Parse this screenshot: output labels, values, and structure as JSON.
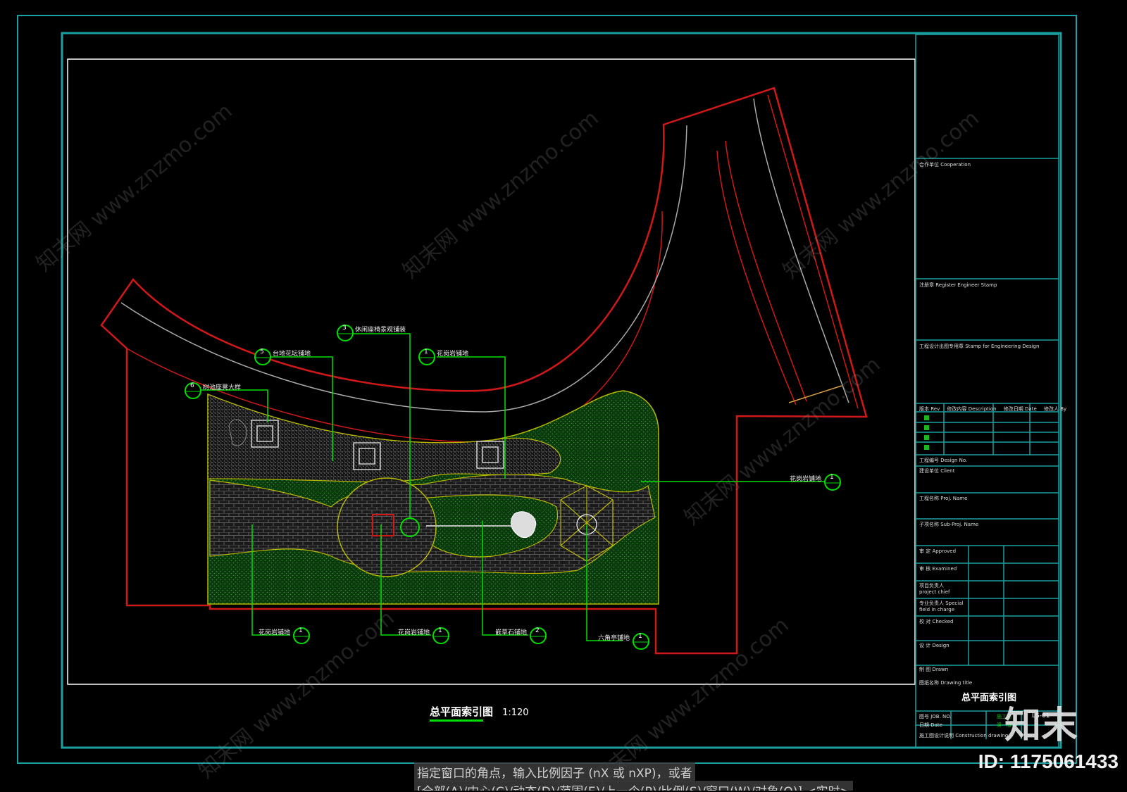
{
  "drawing": {
    "title": "总平面索引图",
    "scale": "1:120",
    "callouts": [
      {
        "num": "5",
        "label": "台地花坛铺地"
      },
      {
        "num": "3",
        "label": "休闲座椅景观铺装"
      },
      {
        "num": "1",
        "label": "花岗岩铺地"
      },
      {
        "num": "6",
        "label": "树池座凳大样"
      },
      {
        "num": "1",
        "label": "花岗岩铺地"
      },
      {
        "num": "1",
        "label": "花岗岩铺地"
      },
      {
        "num": "1",
        "label": "花岗岩铺地"
      },
      {
        "num": "2",
        "label": "嵌草石铺地"
      },
      {
        "num": "1",
        "label": "六角亭铺地"
      }
    ]
  },
  "titleblock": {
    "cooperation": "合作单位 Cooperation",
    "register_stamp": "注册章 Register Engineer Stamp",
    "eng_stamp": "工程设计出图专用章 Stamp for Engineering Design",
    "rev_header": [
      "版本 Rev",
      "修改内容 Description",
      "修改日期 Date",
      "修改人 By"
    ],
    "project_no": "工程编号 Design No.",
    "client": "建设单位 Client",
    "project_name": "工程名称 Proj. Name",
    "sub_project": "子项名称 Sub-Proj. Name",
    "approved": "审 定 Approved",
    "examined": "审 核 Examined",
    "project_chief": "项目负责人 project chief",
    "specialty_charge": "专业负责人 Special field in charge",
    "checked": "校 对 Checked",
    "design": "设 计 Design",
    "drawn": "制 图 Drawn",
    "drawing_title_label": "图纸名称 Drawing title",
    "drawing_title": "总平面索引图",
    "job_no": "图号 JOB. NO.",
    "job_no_val": "施工图",
    "sheet_no": "LS-01",
    "date": "日期 Date",
    "date_val": "第一版",
    "footer": "施工图设计说明 Construction drawing"
  },
  "command": {
    "line1": "指定窗口的角点，输入比例因子 (nX 或 nXP)，或者",
    "line2": "[全部(A)/中心(C)/动态(D)/范围(E)/上一个(P)/比例(S)/窗口(W)/对象(O)] <实时>"
  },
  "watermark": {
    "logo": "知末",
    "id": "ID: 1175061433",
    "text": "知末网 www.znzmo.com"
  },
  "colors": {
    "frame": "#1aa0a0",
    "sheet": "#ffffff",
    "road": "#d01818",
    "plan": "#b8b800",
    "leader": "#00e000",
    "grass": "#0d4a10"
  }
}
